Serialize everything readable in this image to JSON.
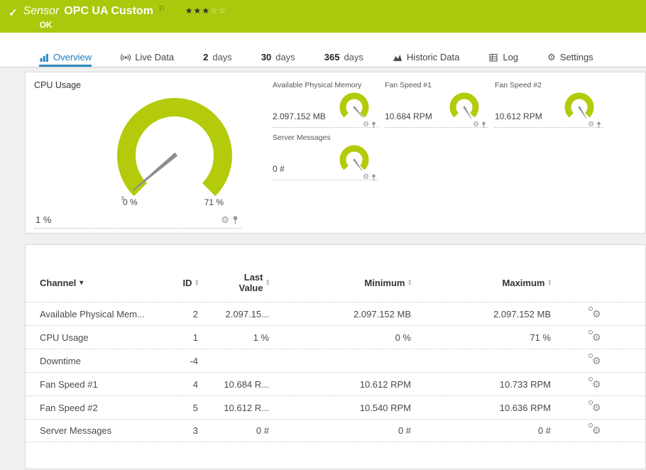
{
  "header": {
    "kind": "Sensor",
    "title": "OPC UA Custom",
    "status": "OK",
    "rating": {
      "filled": "★★★",
      "empty": "☆☆"
    }
  },
  "icons": {
    "check": "✓",
    "flag": "⚐",
    "gear": "⚙",
    "caret_down": "▾",
    "sort_up": "▴",
    "sort_down": "▾",
    "avg_marker": "x̄"
  },
  "tabs": [
    {
      "label": "Overview"
    },
    {
      "label": "Live Data"
    },
    {
      "num": "2",
      "unit": "days"
    },
    {
      "num": "30",
      "unit": "days"
    },
    {
      "num": "365",
      "unit": "days"
    },
    {
      "label": "Historic Data"
    },
    {
      "label": "Log"
    },
    {
      "label": "Settings"
    }
  ],
  "main_gauge": {
    "title": "CPU Usage",
    "value": "1 %",
    "scale_min": "0 %",
    "scale_max": "71 %",
    "needle_deg": 230
  },
  "mini_gauges": [
    {
      "title": "Available Physical Memory",
      "value": "2.097.152 MB",
      "needle_deg": 140
    },
    {
      "title": "Fan Speed #1",
      "value": "10.684 RPM",
      "needle_deg": 148
    },
    {
      "title": "Fan Speed #2",
      "value": "10.612 RPM",
      "needle_deg": 148
    },
    {
      "title": "Server Messages",
      "value": "0 #",
      "needle_deg": 145
    }
  ],
  "table": {
    "headers": {
      "channel": "Channel",
      "id": "ID",
      "last": "Last Value",
      "min": "Minimum",
      "max": "Maximum"
    },
    "rows": [
      {
        "channel": "Available Physical Mem...",
        "id": "2",
        "last": "2.097.15...",
        "min": "2.097.152 MB",
        "max": "2.097.152 MB"
      },
      {
        "channel": "CPU Usage",
        "id": "1",
        "last": "1 %",
        "min": "0 %",
        "max": "71 %"
      },
      {
        "channel": "Downtime",
        "id": "-4",
        "last": "",
        "min": "",
        "max": ""
      },
      {
        "channel": "Fan Speed #1",
        "id": "4",
        "last": "10.684 R...",
        "min": "10.612 RPM",
        "max": "10.733 RPM"
      },
      {
        "channel": "Fan Speed #2",
        "id": "5",
        "last": "10.612 R...",
        "min": "10.540 RPM",
        "max": "10.636 RPM"
      },
      {
        "channel": "Server Messages",
        "id": "3",
        "last": "0 #",
        "min": "0 #",
        "max": "0 #"
      }
    ]
  },
  "colors": {
    "accent_green": "#a9c90d",
    "gauge_green": "#b3cb0b",
    "active_blue": "#2e8ac2"
  }
}
